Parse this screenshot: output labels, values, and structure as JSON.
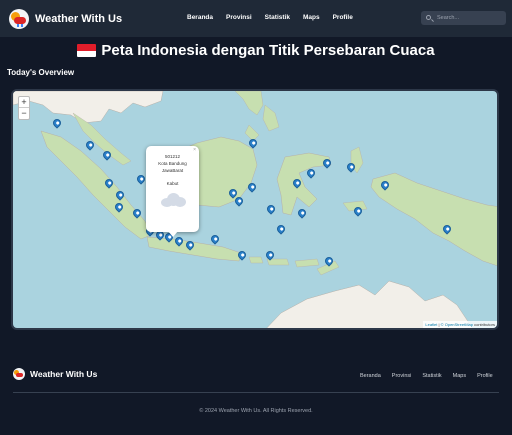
{
  "header": {
    "brand": "Weather With Us",
    "nav": [
      "Beranda",
      "Provinsi",
      "Statistik",
      "Maps",
      "Profile"
    ],
    "search_placeholder": "Search..."
  },
  "main": {
    "title": "Peta Indonesia dengan Titik Persebaran Cuaca",
    "section_heading": "Today's Overview"
  },
  "map": {
    "zoom_in": "+",
    "zoom_out": "−",
    "attribution_prefix": "Leaflet",
    "attribution_source": "© OpenStreetMap",
    "attribution_suffix": "contributors",
    "popup": {
      "close": "×",
      "code": "501212",
      "city": "Kota Bandung",
      "province": "JawaBarat",
      "condition": "Kabut",
      "icon": "cloud-icon"
    },
    "marker_count": 46
  },
  "footer": {
    "brand": "Weather With Us",
    "nav": [
      "Beranda",
      "Provinsi",
      "Statistik",
      "Maps",
      "Profile"
    ],
    "copyright": "© 2024 Weather With Us. All Rights Reserved."
  },
  "colors": {
    "background": "#111827",
    "navbar": "#1f2937",
    "sea": "#aad3df",
    "land": "#f2efe9",
    "forest": "#c7dfb0",
    "marker": "#2a81cb"
  }
}
